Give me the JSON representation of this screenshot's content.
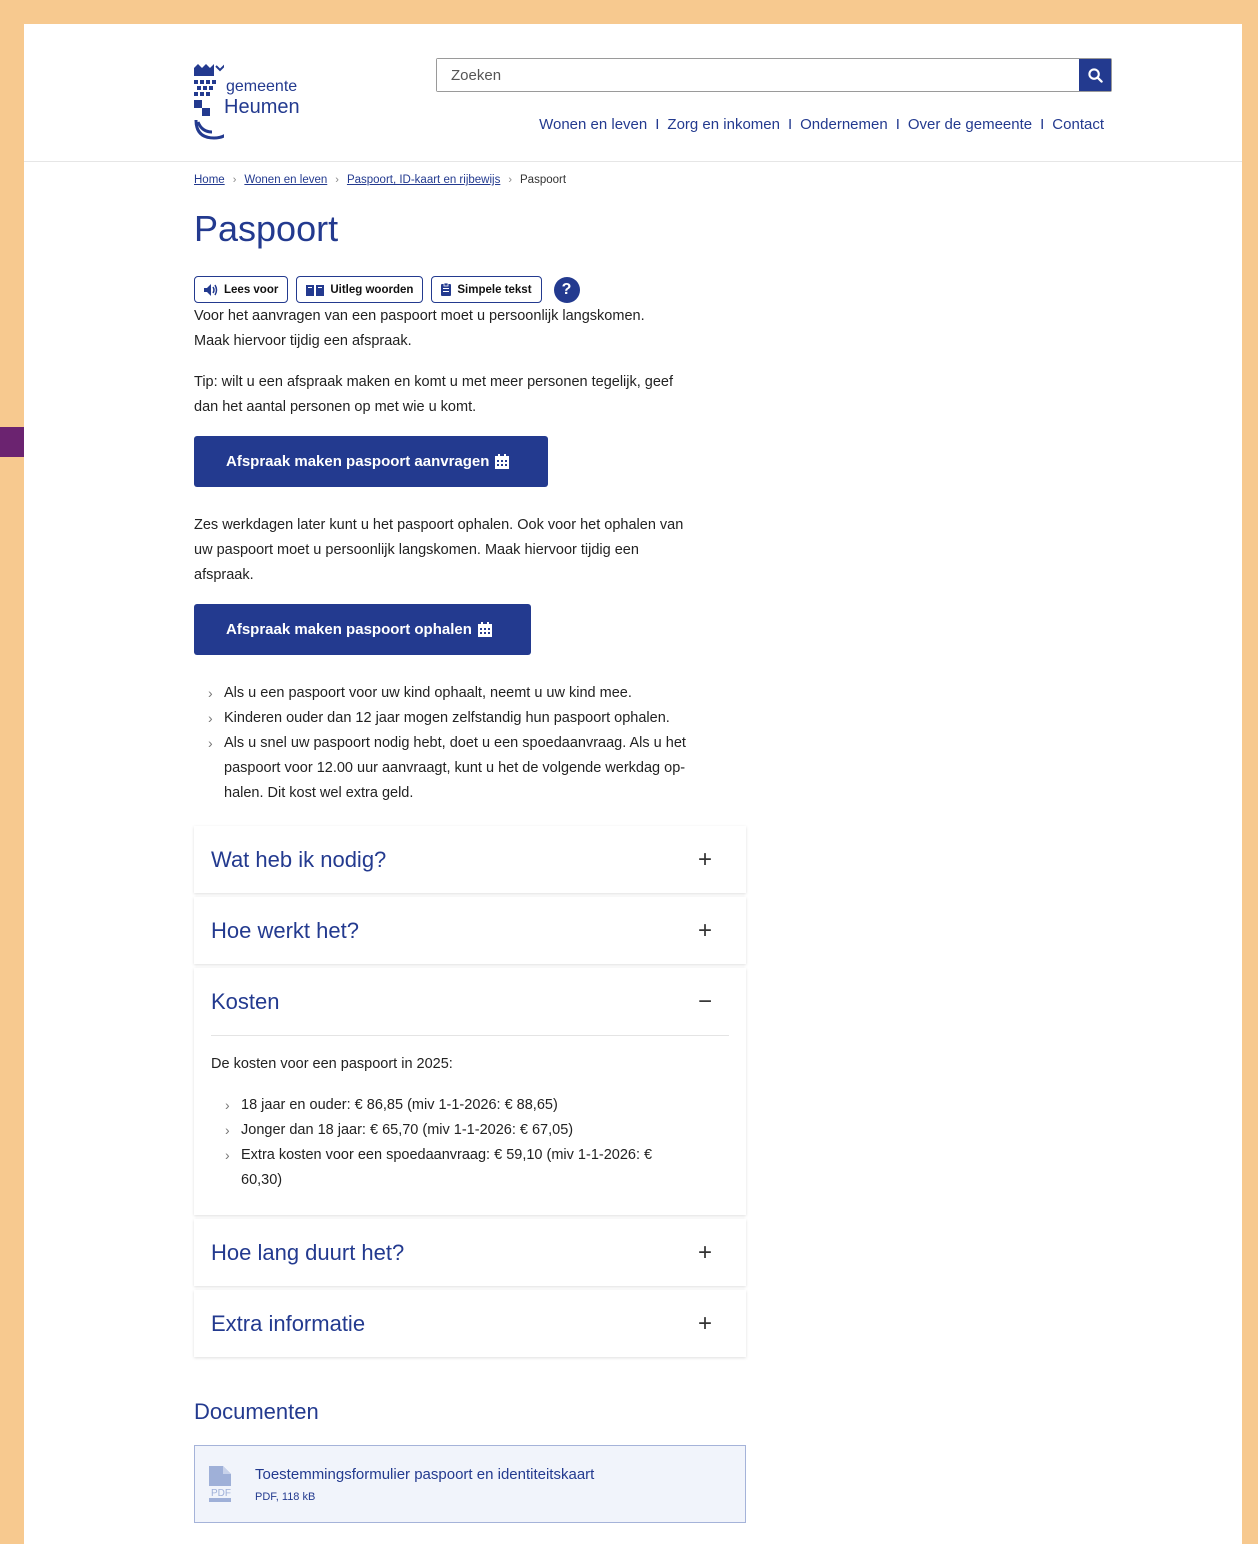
{
  "header": {
    "logo_line1": "gemeente",
    "logo_line2": "Heumen",
    "search_placeholder": "Zoeken",
    "nav": [
      "Wonen en leven",
      "Zorg en inkomen",
      "Ondernemen",
      "Over de gemeente",
      "Contact"
    ],
    "nav_separator": "I"
  },
  "breadcrumb": [
    "Home",
    "Wonen en leven",
    "Paspoort, ID-kaart en rijbewijs",
    "Paspoort"
  ],
  "page_title": "Paspoort",
  "tools": {
    "read_aloud": "Lees voor",
    "explain_words": "Uitleg woorden",
    "simple_text": "Simpele tekst",
    "help": "?"
  },
  "intro_lines": [
    "Voor het aanvragen van een paspoort moet u persoonlijk langskomen.",
    "Maak hiervoor tijdig een afspraak."
  ],
  "tip_lines": [
    "Tip: wilt u een afspraak maken en komt u met meer personen tegelijk, geef",
    "dan het aantal personen op met wie u komt."
  ],
  "cta_apply": "Afspraak maken paspoort aanvragen",
  "pickup_lines": [
    "Zes werkdagen later kunt u het paspoort ophalen. Ook voor het ophalen van",
    "uw paspoort moet u persoonlijk langskomen. Maak hiervoor tijdig een",
    "afspraak."
  ],
  "cta_pickup": "Afspraak maken paspoort ophalen",
  "bullets": [
    [
      "Als u een paspoort voor uw kind ophaalt, neemt u uw kind mee."
    ],
    [
      "Kinderen ouder dan 12 jaar mogen zelfstandig hun paspoort ophalen."
    ],
    [
      "Als u snel uw paspoort nodig hebt, doet u een spoedaanvraag. Als u het",
      "paspoort voor 12.00 uur aanvraagt, kunt u het de volgende werkdag op-",
      "halen. Dit kost wel extra geld."
    ]
  ],
  "accordion": [
    {
      "title": "Wat heb ik nodig?",
      "sign": "+"
    },
    {
      "title": "Hoe werkt het?",
      "sign": "+"
    },
    {
      "title": "Kosten",
      "sign": "−"
    },
    {
      "title": "Hoe lang duurt het?",
      "sign": "+"
    },
    {
      "title": "Extra informatie",
      "sign": "+"
    }
  ],
  "kosten": {
    "intro": "De kosten voor een paspoort in 2025:",
    "items": [
      [
        "18 jaar en ouder: € 86,85 (miv 1-1-2026: € 88,65)"
      ],
      [
        "Jonger dan 18 jaar: € 65,70 (miv 1-1-2026: € 67,05)"
      ],
      [
        "Extra kosten voor een spoedaanvraag: € 59,10 (miv 1-1-2026: €",
        "60,30)"
      ]
    ]
  },
  "documents": {
    "heading": "Documenten",
    "items": [
      {
        "title": "Toestemmingsformulier paspoort en identiteitskaart",
        "meta": "PDF, 118 kB",
        "icon_label": "PDF"
      }
    ]
  },
  "colors": {
    "brand": "#233a8f",
    "frame": "#f7c98f",
    "annotation_arrow": "#6b2370"
  }
}
